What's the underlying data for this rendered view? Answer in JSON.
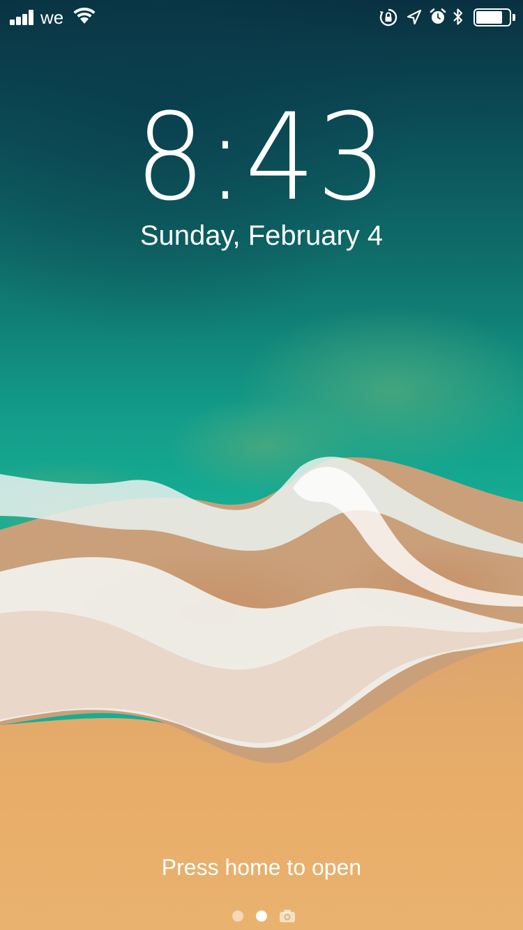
{
  "status_bar": {
    "carrier": "we",
    "signal_bars": 4,
    "wifi_icon": "wifi-icon",
    "right_icons": [
      "orientation-lock-icon",
      "location-arrow-icon",
      "alarm-icon",
      "bluetooth-icon",
      "battery-icon"
    ],
    "battery_level": 0.8
  },
  "lock_screen": {
    "time": "8:43",
    "date": "Sunday, February 4",
    "hint": "Press home to open"
  },
  "pager": {
    "pages": 2,
    "current_page": 2,
    "camera_icon": "camera-icon"
  },
  "wallpaper": {
    "description_icon": "ocean-beach-wallpaper",
    "colors": {
      "deep_ocean": "#0b3b4c",
      "teal": "#12a893",
      "foam": "#f2f2ee",
      "sand": "#e4a968"
    }
  }
}
